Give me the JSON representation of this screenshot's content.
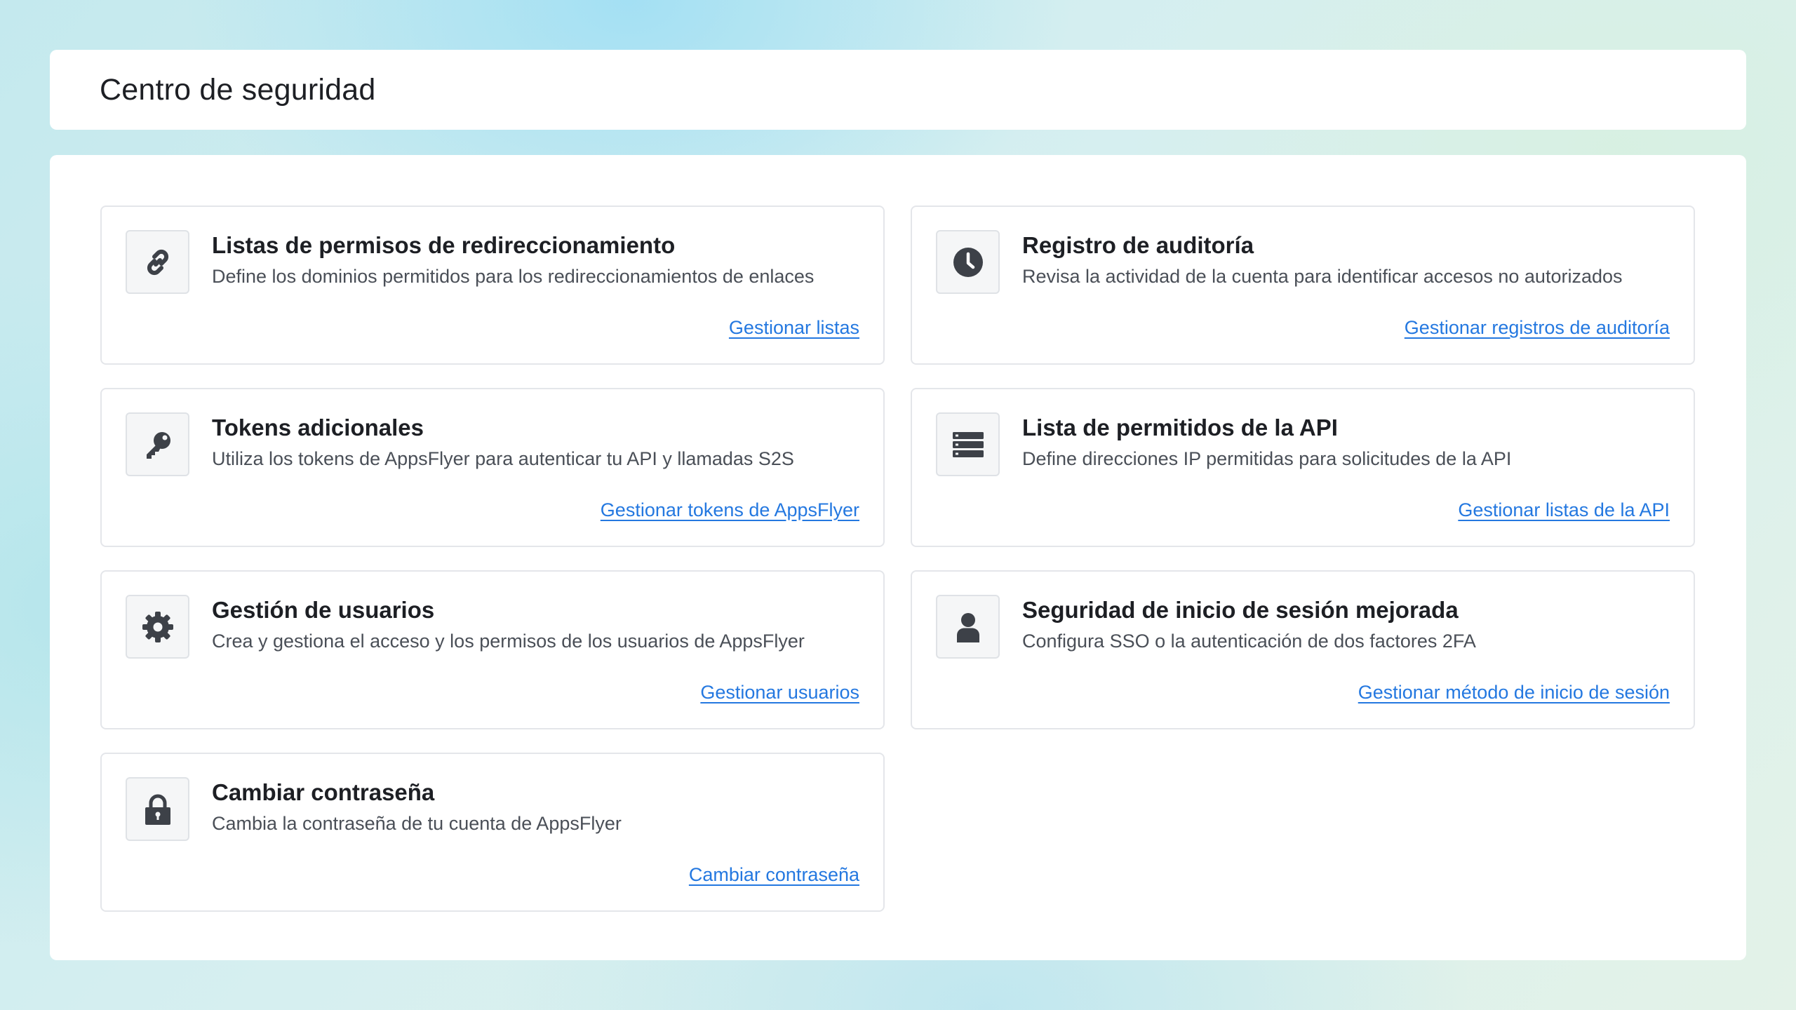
{
  "header": {
    "title": "Centro de seguridad"
  },
  "cards": [
    {
      "icon": "link-icon",
      "title": "Listas de permisos de redireccionamiento",
      "description": "Define los dominios permitidos para los redireccionamientos de enlaces",
      "link": "Gestionar listas"
    },
    {
      "icon": "clock-icon",
      "title": "Registro de auditoría",
      "description": "Revisa la actividad de la cuenta para identificar accesos no autorizados",
      "link": "Gestionar registros de auditoría"
    },
    {
      "icon": "key-icon",
      "title": "Tokens adicionales",
      "description": "Utiliza los tokens de AppsFlyer para autenticar tu API y llamadas S2S",
      "link": "Gestionar tokens de AppsFlyer"
    },
    {
      "icon": "server-list-icon",
      "title": "Lista de permitidos de la API",
      "description": "Define direcciones IP permitidas para solicitudes de la API",
      "link": "Gestionar listas de la API"
    },
    {
      "icon": "gear-icon",
      "title": "Gestión de usuarios",
      "description": "Crea y gestiona el acceso y los permisos de los usuarios de AppsFlyer",
      "link": "Gestionar usuarios"
    },
    {
      "icon": "user-icon",
      "title": "Seguridad de inicio de sesión mejorada",
      "description": "Configura SSO o la autenticación de dos factores 2FA",
      "link": "Gestionar método de inicio de sesión"
    },
    {
      "icon": "lock-icon",
      "title": "Cambiar contraseña",
      "description": "Cambia la contraseña de tu cuenta de AppsFlyer",
      "link": "Cambiar contraseña"
    }
  ],
  "colors": {
    "link": "#2478e0",
    "icon": "#3d4148",
    "card_border": "#e4e6ea"
  }
}
